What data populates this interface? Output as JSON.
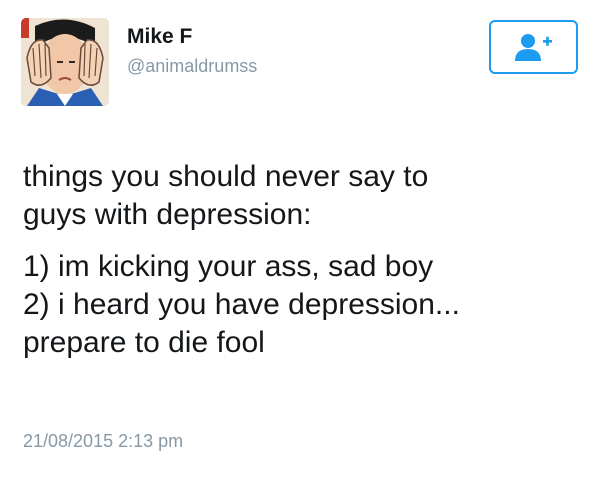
{
  "user": {
    "display_name": "Mike F",
    "handle": "@animaldrumss"
  },
  "follow_button": {
    "icon": "add-user-icon",
    "plus": "+"
  },
  "tweet": {
    "paragraphs": [
      [
        "things you should never say to",
        "guys with depression:"
      ],
      [
        "1) im kicking your ass, sad boy",
        "2) i heard you have depression...",
        "prepare to die fool"
      ]
    ],
    "timestamp": "21/08/2015 2:13 pm"
  },
  "colors": {
    "accent": "#1d9bf0",
    "secondary_text": "#8899a6",
    "primary_text": "#14171a"
  }
}
